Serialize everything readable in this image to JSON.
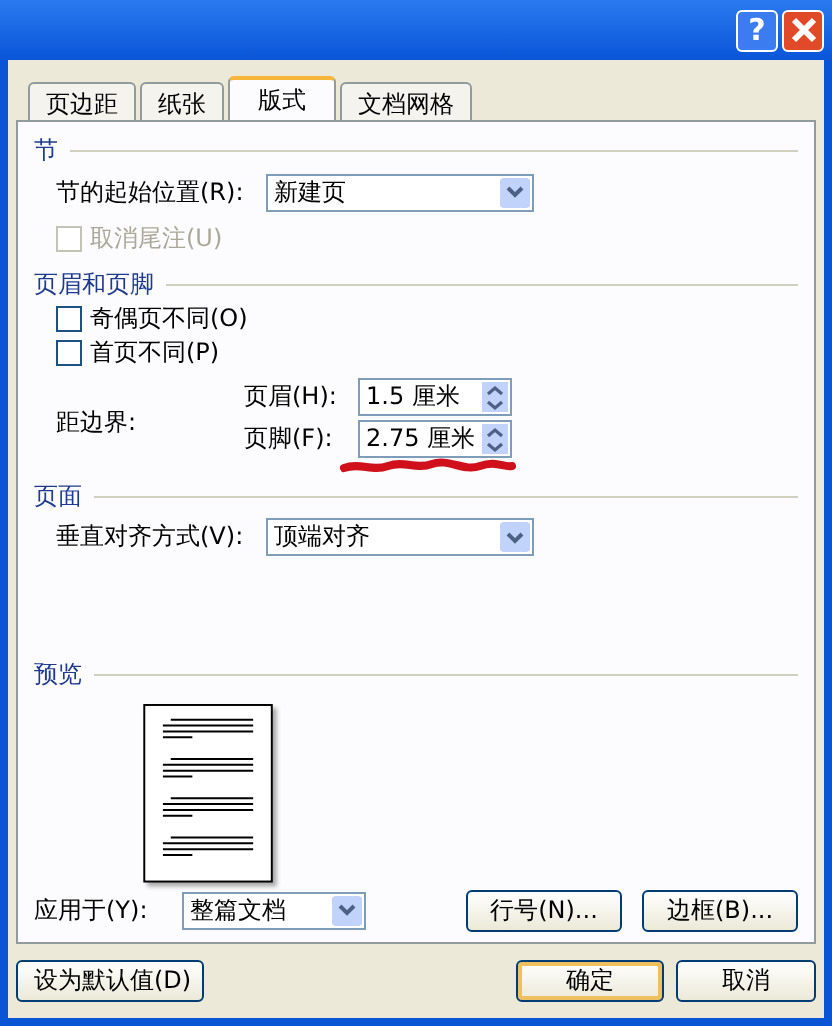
{
  "window": {
    "help": "?"
  },
  "tabs": [
    {
      "label": "页边距",
      "selected": false
    },
    {
      "label": "纸张",
      "selected": false
    },
    {
      "label": "版式",
      "selected": true
    },
    {
      "label": "文档网格",
      "selected": false
    }
  ],
  "section": {
    "title": "节",
    "start_label": "节的起始位置(R):",
    "start_value": "新建页",
    "suppress_endnotes": {
      "label": "取消尾注(U)",
      "checked": false,
      "disabled": true
    }
  },
  "header_footer": {
    "title": "页眉和页脚",
    "options": [
      {
        "label": "奇偶页不同(O)",
        "checked": false
      },
      {
        "label": "首页不同(P)",
        "checked": false
      }
    ],
    "margin_label": "距边界:",
    "spins": [
      {
        "label": "页眉(H):",
        "value": "1.5 厘米"
      },
      {
        "label": "页脚(F):",
        "value": "2.75 厘米"
      }
    ]
  },
  "page": {
    "title": "页面",
    "valign_label": "垂直对齐方式(V):",
    "valign_value": "顶端对齐"
  },
  "preview": {
    "title": "预览"
  },
  "apply": {
    "label": "应用于(Y):",
    "value": "整篇文档",
    "buttons": [
      "行号(N)...",
      "边框(B)..."
    ]
  },
  "footer_buttons": [
    {
      "label": "设为默认值(D)",
      "kind": "left"
    },
    {
      "label": "确定",
      "kind": "default"
    },
    {
      "label": "取消",
      "kind": "normal"
    }
  ]
}
